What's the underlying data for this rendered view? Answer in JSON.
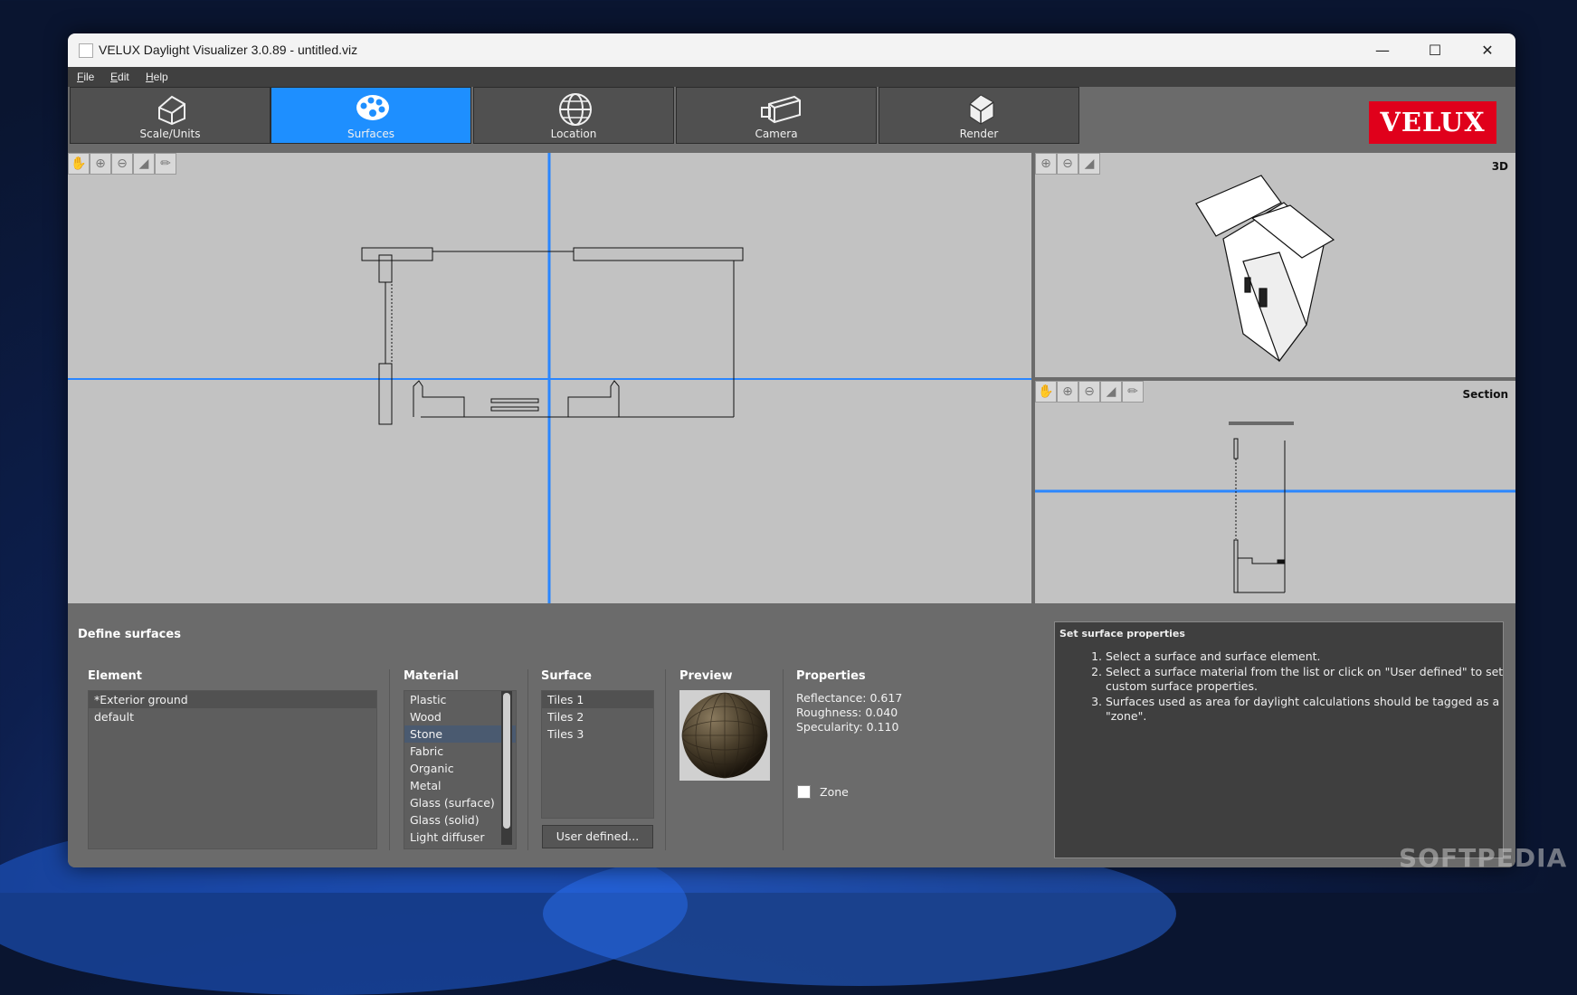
{
  "window": {
    "title": "VELUX Daylight Visualizer 3.0.89 - untitled.viz"
  },
  "menu": [
    "File",
    "Edit",
    "Help"
  ],
  "tabs": [
    {
      "label": "Scale/Units",
      "icon": "house-wireframe-icon",
      "active": false
    },
    {
      "label": "Surfaces",
      "icon": "palette-icon",
      "active": true
    },
    {
      "label": "Location",
      "icon": "globe-icon",
      "active": false
    },
    {
      "label": "Camera",
      "icon": "camera-icon",
      "active": false
    },
    {
      "label": "Render",
      "icon": "render-cube-icon",
      "active": false
    }
  ],
  "logo": {
    "text": "VELUX",
    "color": "#e0001b"
  },
  "views": {
    "view3d_label": "3D",
    "section_label": "Section"
  },
  "define_surfaces": {
    "title": "Define surfaces",
    "element": {
      "header": "Element",
      "items": [
        "*Exterior ground",
        "default"
      ]
    },
    "material": {
      "header": "Material",
      "items": [
        "Plastic",
        "Wood",
        "Stone",
        "Fabric",
        "Organic",
        "Metal",
        "Glass (surface)",
        "Glass (solid)",
        "Light diffuser"
      ],
      "selected": "Stone"
    },
    "surface": {
      "header": "Surface",
      "items": [
        "Tiles 1",
        "Tiles 2",
        "Tiles 3"
      ],
      "selected": "Tiles 1",
      "user_defined_button": "User defined..."
    },
    "preview": {
      "header": "Preview"
    },
    "properties": {
      "header": "Properties",
      "reflectance": "Reflectance: 0.617",
      "roughness": "Roughness: 0.040",
      "specularity": "Specularity: 0.110",
      "zone_label": "Zone"
    }
  },
  "help": {
    "title": "Set surface properties",
    "steps": [
      "Select a surface and surface element.",
      "Select a surface material from the list or click on \"User defined\" to set custom surface properties.",
      "Surfaces used as area for daylight calculations should be tagged as a \"zone\"."
    ]
  },
  "watermark": "SOFTPEDIA",
  "colors": {
    "accent": "#1e8fff",
    "panel": "#6b6b6b",
    "viewport": "#c2c2c2"
  }
}
